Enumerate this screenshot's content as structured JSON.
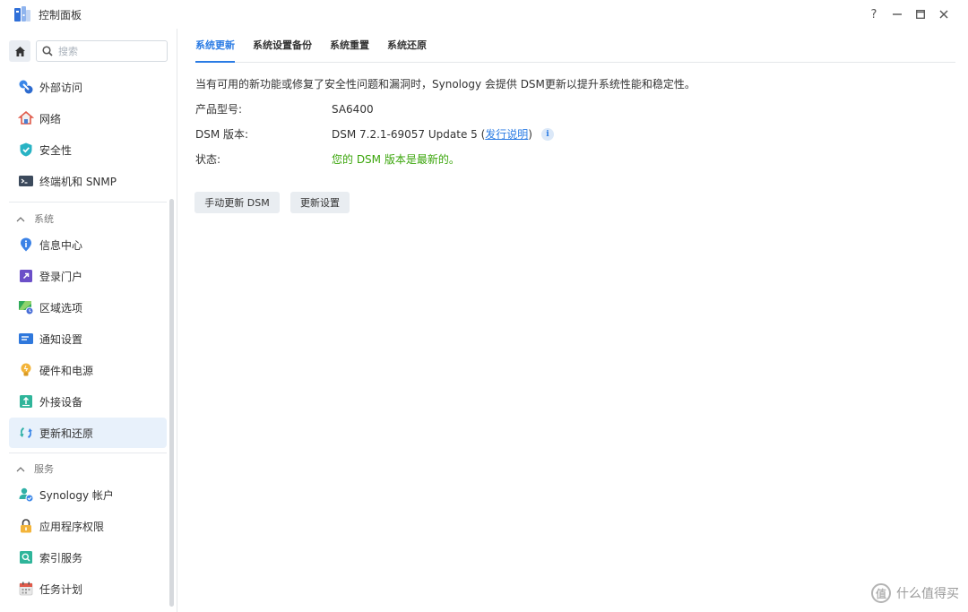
{
  "window": {
    "title": "控制面板",
    "controls": [
      "help-icon",
      "minimize-icon",
      "maximize-icon",
      "close-icon"
    ]
  },
  "sidebar": {
    "search_placeholder": "搜索",
    "items_top": [
      {
        "label": "外部访问",
        "icon": "external-access-icon"
      },
      {
        "label": "网络",
        "icon": "network-house-icon"
      },
      {
        "label": "安全性",
        "icon": "shield-icon"
      },
      {
        "label": "终端机和 SNMP",
        "icon": "terminal-icon"
      }
    ],
    "group_system": "系统",
    "items_system": [
      {
        "label": "信息中心",
        "icon": "info-center-icon"
      },
      {
        "label": "登录门户",
        "icon": "login-portal-icon"
      },
      {
        "label": "区域选项",
        "icon": "regional-options-icon"
      },
      {
        "label": "通知设置",
        "icon": "notification-icon"
      },
      {
        "label": "硬件和电源",
        "icon": "bulb-icon"
      },
      {
        "label": "外接设备",
        "icon": "external-device-icon"
      },
      {
        "label": "更新和还原",
        "icon": "update-restore-icon",
        "active": true
      }
    ],
    "group_services": "服务",
    "items_services": [
      {
        "label": "Synology 帐户",
        "icon": "synology-account-icon"
      },
      {
        "label": "应用程序权限",
        "icon": "lock-icon"
      },
      {
        "label": "索引服务",
        "icon": "index-search-icon"
      },
      {
        "label": "任务计划",
        "icon": "calendar-icon"
      }
    ]
  },
  "tabs": [
    {
      "label": "系统更新",
      "active": true
    },
    {
      "label": "系统设置备份"
    },
    {
      "label": "系统重置"
    },
    {
      "label": "系统还原"
    }
  ],
  "content": {
    "description": "当有可用的新功能或修复了安全性问题和漏洞时，Synology 会提供 DSM更新以提升系统性能和稳定性。",
    "model_label": "产品型号:",
    "model_value": "SA6400",
    "dsm_label": "DSM 版本:",
    "dsm_value_prefix": "DSM 7.2.1-69057 Update 5 (",
    "release_notes": "发行说明",
    "dsm_value_suffix": ")",
    "status_label": "状态:",
    "status_value": "您的 DSM 版本是最新的。",
    "status_color": "#3aa50a",
    "manual_update_button": "手动更新 DSM",
    "update_settings_button": "更新设置"
  },
  "accent_color": "#2a7be4",
  "watermark": "什么值得买"
}
